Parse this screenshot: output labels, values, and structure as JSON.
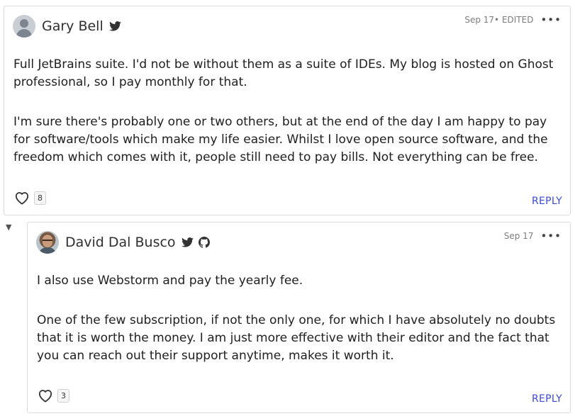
{
  "comments": [
    {
      "author": "Gary Bell",
      "date": "Sep 17",
      "edited": " • EDITED",
      "more": "•••",
      "paragraphs": [
        "Full JetBrains suite. I'd not be without them as a suite of IDEs. My blog is hosted on Ghost professional, so I pay monthly for that.",
        "I'm sure there's probably one or two others, but at the end of the day I am happy to pay for software/tools which make my life easier. Whilst I love open source software, and the freedom which comes with it, people still need to pay bills. Not everything can be free."
      ],
      "likes": "8",
      "reply_label": "REPLY",
      "icons": [
        "default-avatar-icon",
        "twitter-icon",
        "heart-icon"
      ]
    },
    {
      "author": "David Dal Busco",
      "date": "Sep 17",
      "more": "•••",
      "paragraphs": [
        "I also use Webstorm and pay the yearly fee.",
        "One of the few subscription, if not the only one, for which I have absolutely no doubts that it is worth the money. I am just more effective with their editor and the fact that you can reach out their support anytime, makes it worth it."
      ],
      "likes": "3",
      "reply_label": "REPLY",
      "icons": [
        "twitter-icon",
        "github-icon",
        "heart-icon"
      ]
    }
  ],
  "thread": {
    "collapse_glyph": "▼"
  },
  "colors": {
    "link": "#3b49df",
    "border": "#dcdcdc",
    "meta": "#7c7c7c"
  }
}
